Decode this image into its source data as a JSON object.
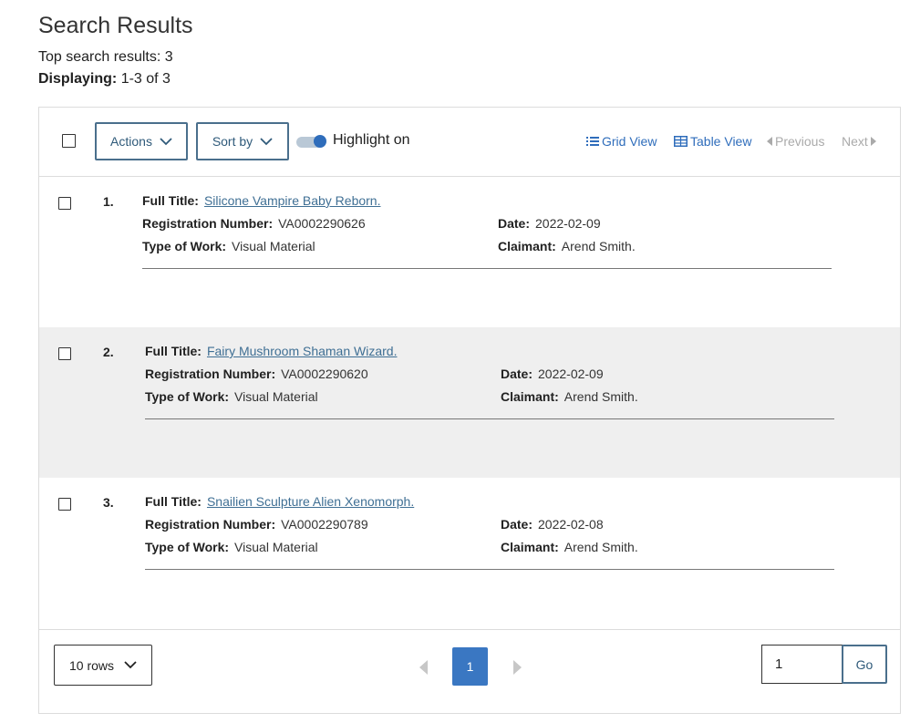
{
  "header": {
    "title": "Search Results",
    "top_results_label": "Top search results:",
    "top_results_count": "3",
    "displaying_label": "Displaying:",
    "displaying_value": "1-3 of 3"
  },
  "toolbar": {
    "actions_label": "Actions",
    "sort_label": "Sort by",
    "highlight_label": "Highlight on",
    "highlight_on": true,
    "grid_view_label": "Grid View",
    "table_view_label": "Table View",
    "previous_label": "Previous",
    "next_label": "Next"
  },
  "labels": {
    "full_title": "Full Title:",
    "registration_number": "Registration Number:",
    "type_of_work": "Type of Work:",
    "date": "Date:",
    "claimant": "Claimant:"
  },
  "results": [
    {
      "number": "1.",
      "full_title": "Silicone Vampire Baby Reborn.",
      "registration_number": "VA0002290626",
      "type_of_work": "Visual Material",
      "date": "2022-02-09",
      "claimant": "Arend Smith."
    },
    {
      "number": "2.",
      "full_title": "Fairy Mushroom Shaman Wizard.",
      "registration_number": "VA0002290620",
      "type_of_work": "Visual Material",
      "date": "2022-02-09",
      "claimant": "Arend Smith."
    },
    {
      "number": "3.",
      "full_title": "Snailien Sculpture Alien Xenomorph.",
      "registration_number": "VA0002290789",
      "type_of_work": "Visual Material",
      "date": "2022-02-08",
      "claimant": "Arend Smith."
    }
  ],
  "footer": {
    "rows_per_page": "10 rows",
    "current_page": "1",
    "goto_value": "1",
    "go_label": "Go"
  },
  "colors": {
    "accent": "#3a77c2",
    "link": "#3f6f94",
    "button_border": "#4a6f8c",
    "shaded_row": "#efefef"
  }
}
